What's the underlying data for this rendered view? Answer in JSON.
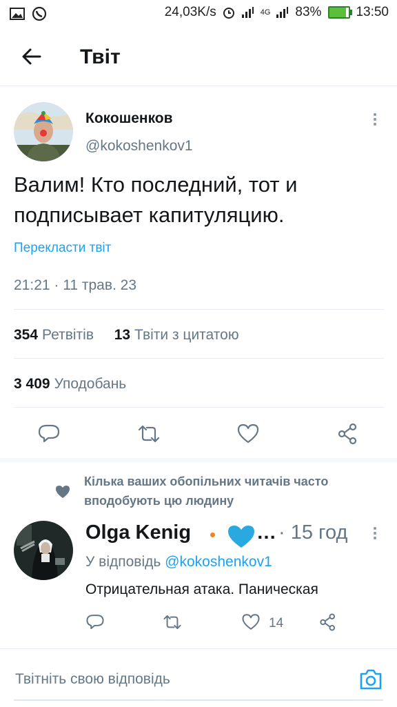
{
  "status_bar": {
    "speed": "24,03K/s",
    "network": "4G",
    "battery": "83%",
    "time": "13:50",
    "icons": [
      "gallery-icon",
      "viber-icon",
      "alarm-icon",
      "signal-icon",
      "battery-icon"
    ]
  },
  "header": {
    "title": "Твіт",
    "back_icon": "arrow-left-icon"
  },
  "tweet": {
    "name": "Кокошенков",
    "handle": "@kokoshenkov1",
    "text": "Валим! Кто последний, тот и подписывает капитуляцию.",
    "translate_label": "Перекласти твіт",
    "timestamp": "21:21 · 11 трав. 23",
    "retweets_count": "354",
    "retweets_label": "Ретвітів",
    "quotes_count": "13",
    "quotes_label": "Твіти з цитатою",
    "likes_count": "3 409",
    "likes_label": "Уподобань"
  },
  "social_context": {
    "text": "Кілька ваших обопільних читачів часто вподобують цю людину"
  },
  "reply": {
    "name": "Olga Kenig",
    "ellipsis": "…",
    "time": "· 15 год",
    "reply_prefix": "У відповідь",
    "reply_handle": "@kokoshenkov1",
    "text": "Отрицательная атака. Паническая",
    "likes": "14"
  },
  "composer": {
    "placeholder": "Твітніть свою відповідь"
  },
  "colors": {
    "accent": "#1da1f2",
    "secondary_text": "#657786",
    "heart_emoji": "#29a9e0",
    "dot": "#f5841f"
  }
}
